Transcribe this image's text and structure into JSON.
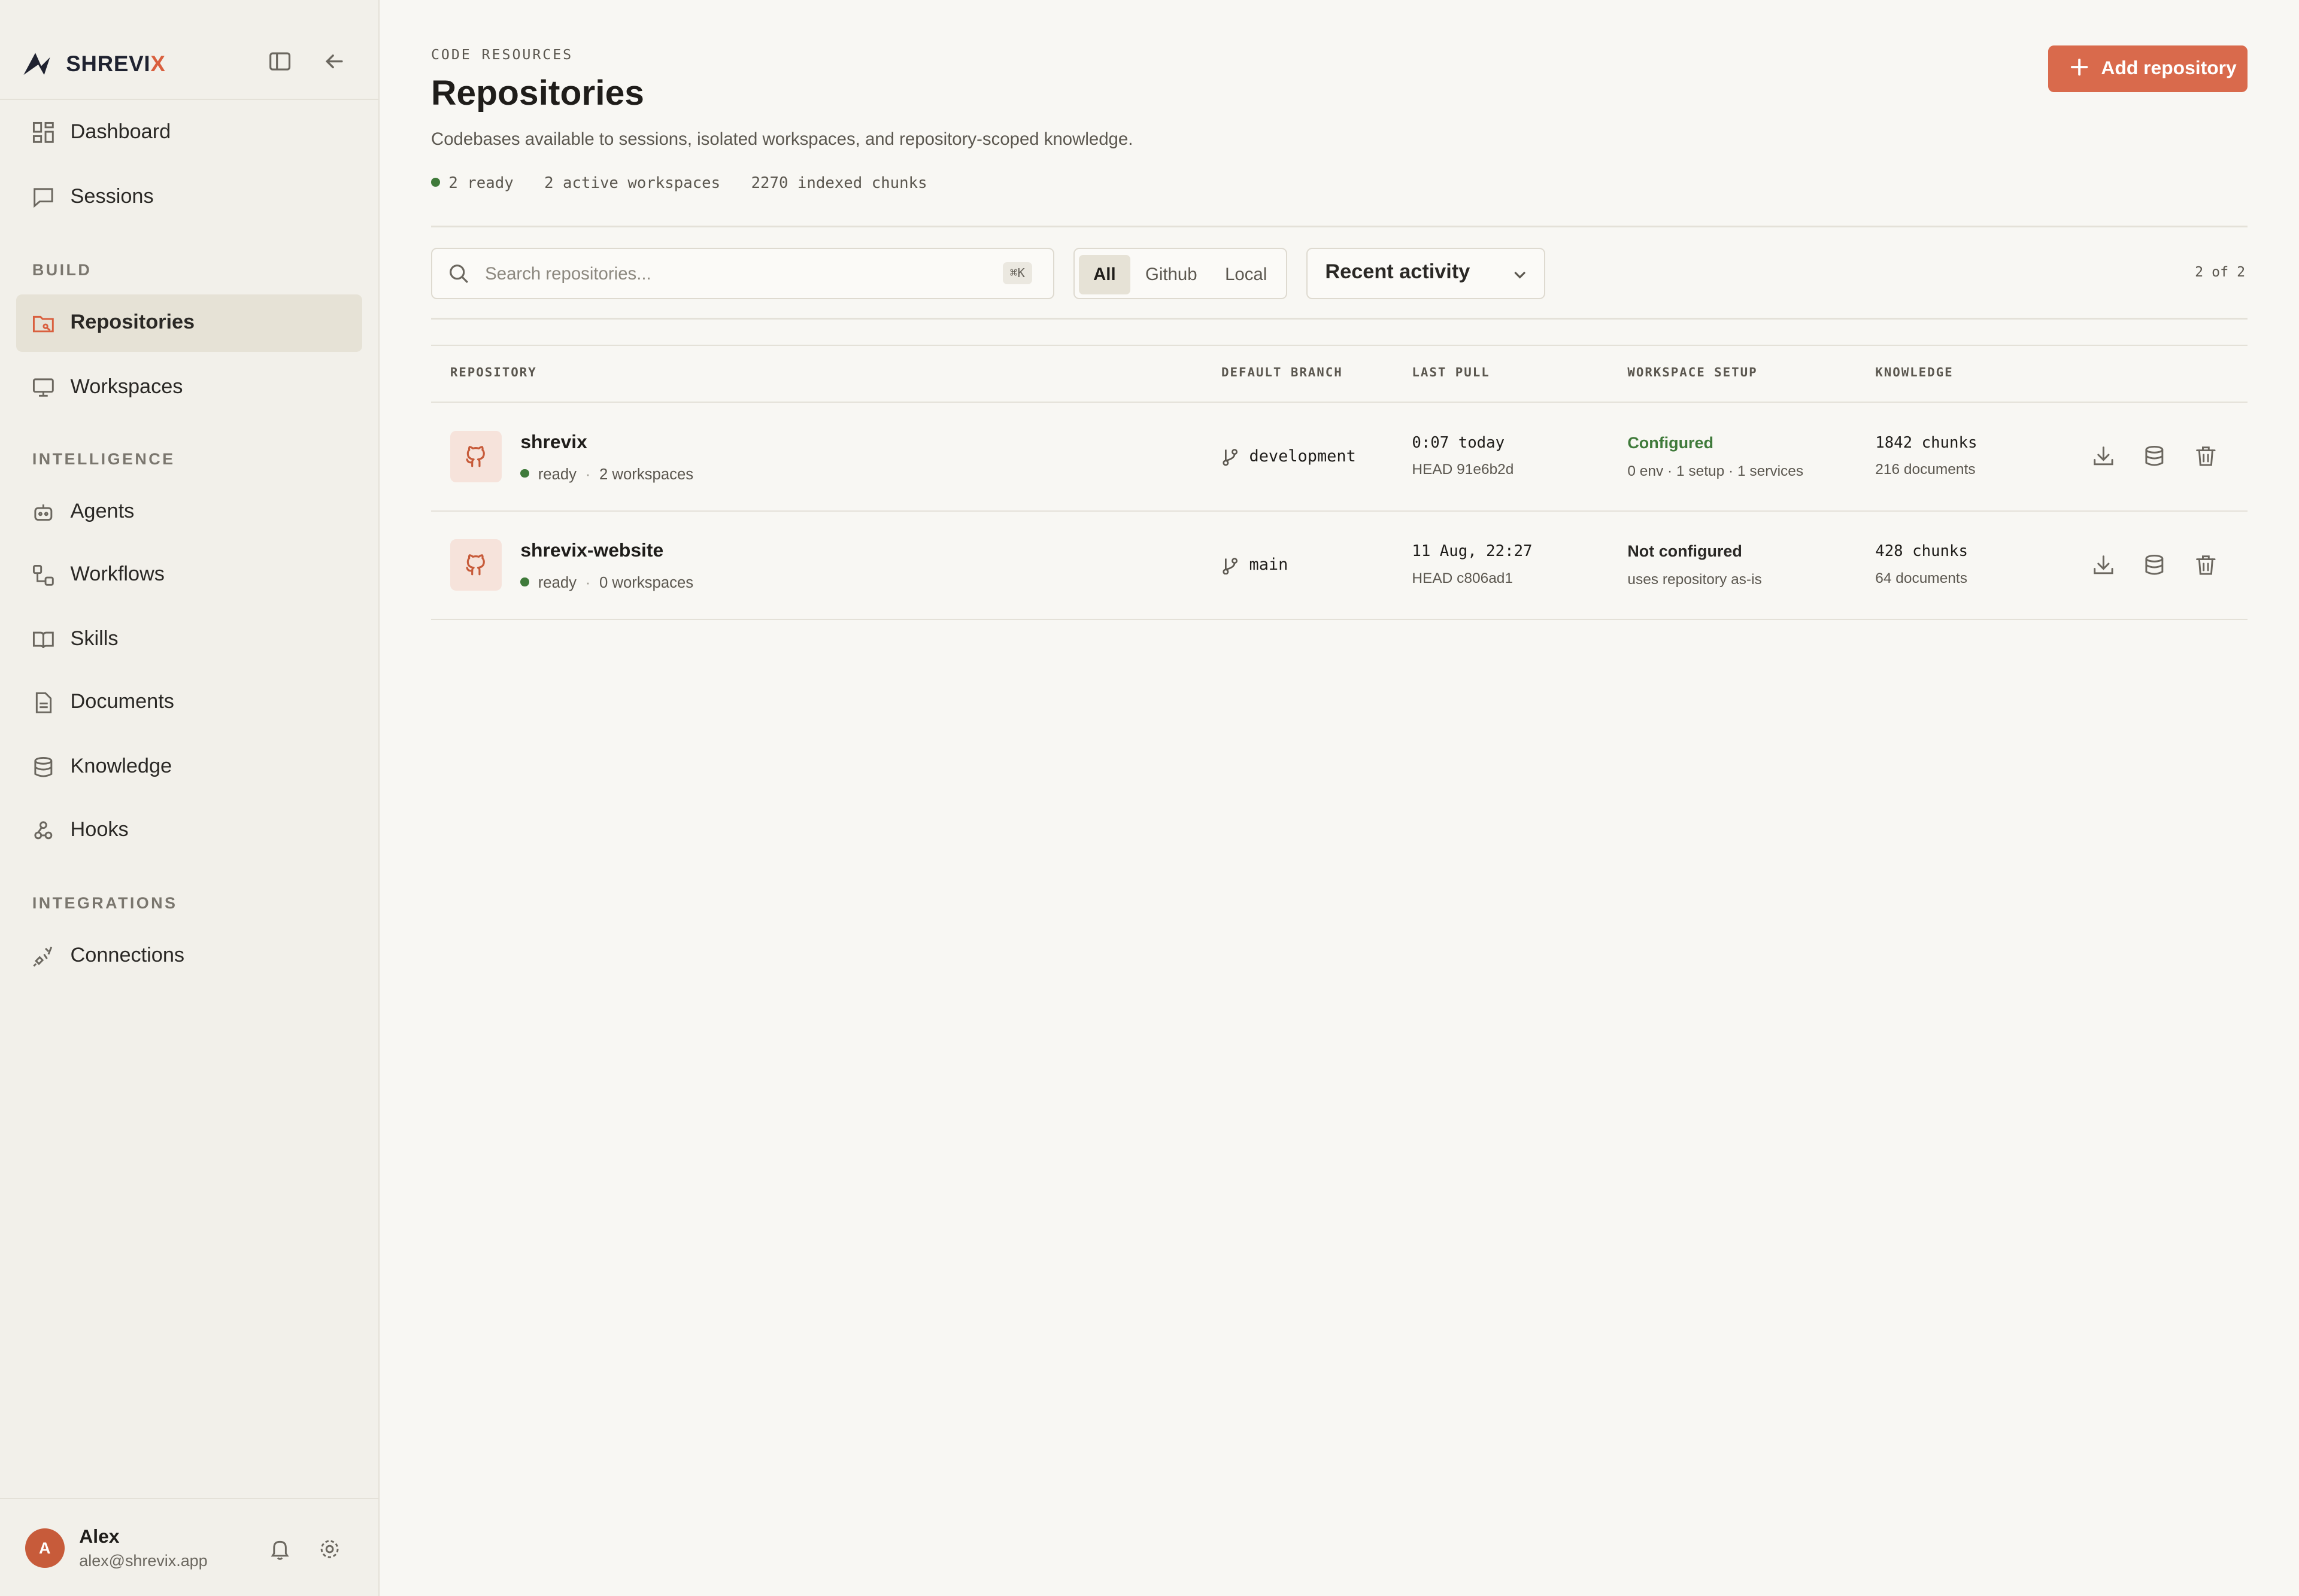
{
  "brand": {
    "name_main": "SHREVI",
    "name_accent": "X",
    "accent_color": "#d95f3e"
  },
  "sidebar": {
    "toggle_icon": "sidebar-panel-icon",
    "collapse_icon": "arrow-left-icon",
    "top_items": [
      {
        "label": "Dashboard",
        "icon": "grid-icon"
      },
      {
        "label": "Sessions",
        "icon": "chat-icon"
      }
    ],
    "sections": [
      {
        "title": "BUILD",
        "items": [
          {
            "label": "Repositories",
            "icon": "folder-git-icon",
            "active": true
          },
          {
            "label": "Workspaces",
            "icon": "monitor-icon"
          }
        ]
      },
      {
        "title": "INTELLIGENCE",
        "items": [
          {
            "label": "Agents",
            "icon": "bot-icon"
          },
          {
            "label": "Workflows",
            "icon": "workflow-icon"
          },
          {
            "label": "Skills",
            "icon": "book-icon"
          },
          {
            "label": "Documents",
            "icon": "file-icon"
          },
          {
            "label": "Knowledge",
            "icon": "database-icon"
          },
          {
            "label": "Hooks",
            "icon": "webhook-icon"
          }
        ]
      },
      {
        "title": "INTEGRATIONS",
        "items": [
          {
            "label": "Connections",
            "icon": "plug-icon"
          }
        ]
      }
    ],
    "user": {
      "initial": "A",
      "name": "Alex",
      "email": "alex@shrevix.app"
    }
  },
  "header": {
    "eyebrow": "CODE RESOURCES",
    "title": "Repositories",
    "subtitle": "Codebases available to sessions, isolated workspaces, and repository-scoped knowledge.",
    "stats": {
      "ready": "2 ready",
      "workspaces": "2 active workspaces",
      "chunks": "2270 indexed chunks"
    },
    "add_button": "Add repository"
  },
  "filters": {
    "search_placeholder": "Search repositories...",
    "search_value": "",
    "shortcut": "⌘K",
    "segments": [
      {
        "label": "All",
        "active": true
      },
      {
        "label": "Github",
        "active": false
      },
      {
        "label": "Local",
        "active": false
      }
    ],
    "sort": "Recent activity",
    "count": "2 of 2"
  },
  "table": {
    "columns": [
      "REPOSITORY",
      "DEFAULT BRANCH",
      "LAST PULL",
      "WORKSPACE SETUP",
      "KNOWLEDGE"
    ],
    "rows": [
      {
        "name": "shrevix",
        "status": "ready",
        "workspaces": "2 workspaces",
        "branch": "development",
        "last_pull": "0:07 today",
        "head": "HEAD 91e6b2d",
        "setup": "Configured",
        "setup_detail": "0 env · 1 setup · 1 services",
        "setup_color": "#3f7a3a",
        "chunks": "1842 chunks",
        "documents": "216 documents"
      },
      {
        "name": "shrevix-website",
        "status": "ready",
        "workspaces": "0 workspaces",
        "branch": "main",
        "last_pull": "11 Aug, 22:27",
        "head": "HEAD c806ad1",
        "setup": "Not configured",
        "setup_detail": "uses repository as-is",
        "setup_color": "#2a2825",
        "chunks": "428 chunks",
        "documents": "64 documents"
      }
    ]
  }
}
